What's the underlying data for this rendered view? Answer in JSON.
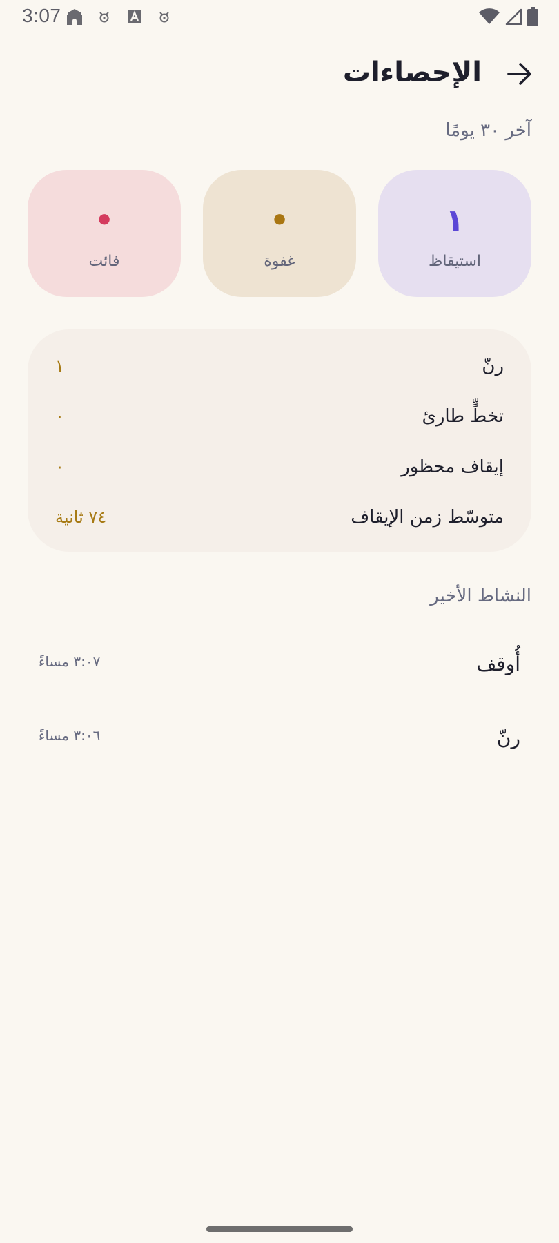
{
  "status_bar": {
    "time": "3:07",
    "notification_icons": [
      "mosque-icon",
      "notification-face-icon",
      "a-box-icon",
      "notification-face-icon"
    ],
    "system_icons": [
      "wifi-icon",
      "cell-signal-icon",
      "battery-icon"
    ]
  },
  "header": {
    "title": "الإحصاءات",
    "back_icon": "arrow-right-icon"
  },
  "range_label": "آخر ٣٠ يومًا",
  "stat_cards": [
    {
      "label": "استيقاظ",
      "value": "١",
      "bg": "#E6DFF0",
      "color": "#5B47D6"
    },
    {
      "label": "غفوة",
      "value": "•",
      "bg": "#EEE3D2",
      "color": "#A97612"
    },
    {
      "label": "فائت",
      "value": "•",
      "bg": "#F5DCDC",
      "color": "#D43B5E"
    }
  ],
  "summary": [
    {
      "label": "رنّ",
      "value": "١"
    },
    {
      "label": "تخطٍّ طارئ",
      "value": "٠"
    },
    {
      "label": "إيقاف محظور",
      "value": "٠"
    },
    {
      "label": "متوسّط زمن الإيقاف",
      "value": "٧٤ ثانية"
    }
  ],
  "recent_activity": {
    "title": "النشاط الأخير",
    "items": [
      {
        "label": "أُوقف",
        "time": "٣:٠٧ مساءً"
      },
      {
        "label": "رنّ",
        "time": "٣:٠٦ مساءً"
      }
    ]
  }
}
